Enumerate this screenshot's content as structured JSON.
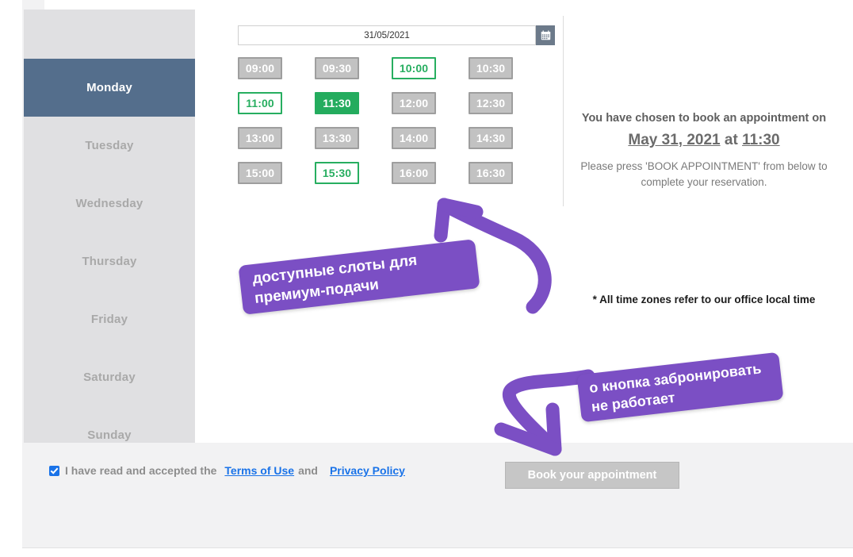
{
  "sidebar": {
    "days": [
      {
        "label": "Monday",
        "selected": true
      },
      {
        "label": "Tuesday",
        "selected": false
      },
      {
        "label": "Wednesday",
        "selected": false
      },
      {
        "label": "Thursday",
        "selected": false
      },
      {
        "label": "Friday",
        "selected": false
      },
      {
        "label": "Saturday",
        "selected": false
      },
      {
        "label": "Sunday",
        "selected": false
      }
    ]
  },
  "date_picker": {
    "value": "31/05/2021",
    "placeholder": "dd/mm/yyyy",
    "icon": "calendar-icon"
  },
  "slots": [
    {
      "time": "09:00",
      "state": "disabled"
    },
    {
      "time": "09:30",
      "state": "disabled"
    },
    {
      "time": "10:00",
      "state": "available"
    },
    {
      "time": "10:30",
      "state": "disabled"
    },
    {
      "time": "11:00",
      "state": "available"
    },
    {
      "time": "11:30",
      "state": "selected"
    },
    {
      "time": "12:00",
      "state": "disabled"
    },
    {
      "time": "12:30",
      "state": "disabled"
    },
    {
      "time": "13:00",
      "state": "disabled"
    },
    {
      "time": "13:30",
      "state": "disabled"
    },
    {
      "time": "14:00",
      "state": "disabled"
    },
    {
      "time": "14:30",
      "state": "disabled"
    },
    {
      "time": "15:00",
      "state": "disabled"
    },
    {
      "time": "15:30",
      "state": "available"
    },
    {
      "time": "16:00",
      "state": "disabled"
    },
    {
      "time": "16:30",
      "state": "disabled"
    }
  ],
  "info": {
    "chosen_line": "You have chosen to book an appointment on",
    "chosen_date": "May 31, 2021",
    "chosen_at": "at",
    "chosen_time": "11:30",
    "press_note": "Please press 'BOOK APPOINTMENT' from below to complete your reservation.",
    "timezone_note": "* All time zones refer to our office local time"
  },
  "bottom": {
    "terms_prefix": "I have read and accepted the",
    "terms_link": "Terms of Use",
    "terms_conjunction": "and",
    "privacy_link": "Privacy Policy",
    "book_button": "Book your appointment",
    "checkbox_checked": true
  },
  "annotations": [
    {
      "id": "callout-available-slots",
      "text": "доступные слоты для премиум-подачи",
      "color": "#7b4fc4"
    },
    {
      "id": "callout-book-button-broken",
      "text": "о кнопка забронировать не работает",
      "color": "#7b4fc4"
    }
  ],
  "colors": {
    "selected_day": "#546e8c",
    "available_slot": "#27ae60",
    "selected_slot": "#24ac5e",
    "disabled_slot": "#c2c2c2",
    "link": "#1a73e8",
    "annotation": "#7b4fc4"
  }
}
